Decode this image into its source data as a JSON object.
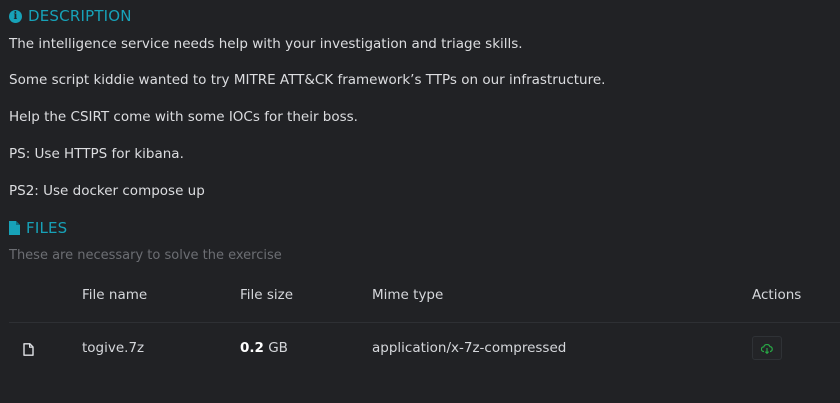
{
  "description": {
    "heading": "DESCRIPTION",
    "icon": "info-icon",
    "lines": [
      "The intelligence service needs help with your investigation and triage skills.",
      "Some script kiddie wanted to try MITRE ATT&CK framework’s TTPs on our infrastructure.",
      "Help the CSIRT come with some IOCs for their boss.",
      "PS: Use HTTPS for kibana.",
      "PS2: Use docker compose up"
    ]
  },
  "files": {
    "heading": "FILES",
    "icon": "file-icon",
    "subtitle": "These are necessary to solve the exercise",
    "columns": {
      "name": "File name",
      "size": "File size",
      "mime": "Mime type",
      "actions": "Actions"
    },
    "rows": [
      {
        "icon": "file-icon",
        "name": "togive.7z",
        "size_value": "0.2",
        "size_unit": "GB",
        "mime": "application/x-7z-compressed",
        "action_icon": "cloud-download-icon"
      }
    ]
  },
  "colors": {
    "background": "#212225",
    "accent": "#17a2b8",
    "download": "#28a745",
    "muted": "#6c6e73"
  }
}
